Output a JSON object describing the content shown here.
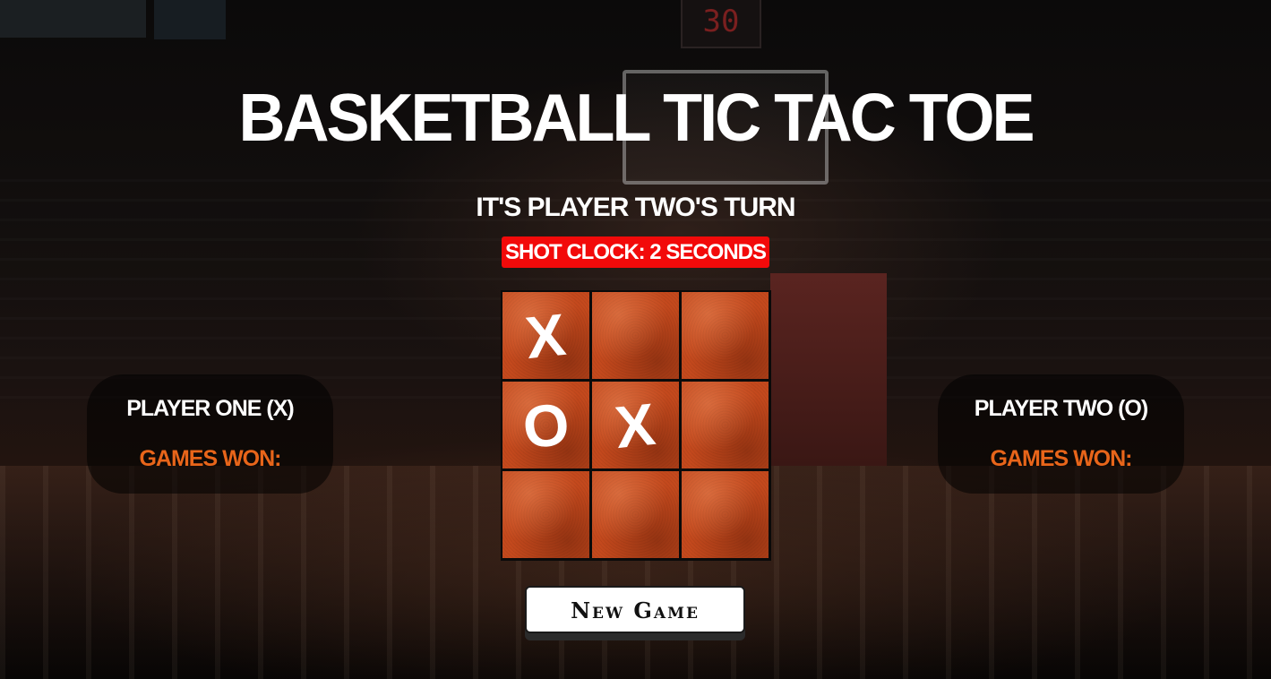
{
  "background": {
    "scoreboard_digits": "30"
  },
  "title": "BASKETBALL TIC TAC TOE",
  "turn_text": "IT'S PLAYER TWO'S TURN",
  "shot_clock_text": "SHOT CLOCK: 2 SECONDS",
  "board": {
    "cells": [
      "X",
      "",
      "",
      "O",
      "X",
      "",
      "",
      "",
      ""
    ]
  },
  "players": [
    {
      "name": "PLAYER ONE (X)",
      "games_won_label": "GAMES WON:"
    },
    {
      "name": "PLAYER TWO (O)",
      "games_won_label": "GAMES WON:"
    }
  ],
  "new_game_label": "New Game",
  "colors": {
    "shot_clock_bg": "#f20a0a",
    "games_won_text": "#e8651a",
    "cell_base": "#c4491d"
  }
}
